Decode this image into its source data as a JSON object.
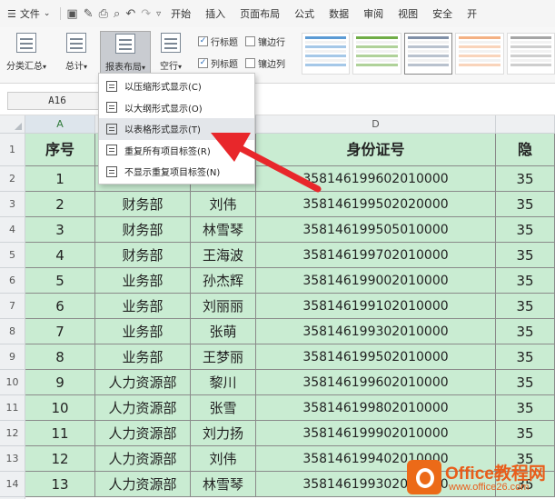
{
  "menubar": {
    "file_label": "文件",
    "tabs": [
      "开始",
      "插入",
      "页面布局",
      "公式",
      "数据",
      "审阅",
      "视图",
      "安全",
      "开"
    ]
  },
  "ribbon": {
    "subtotal_label": "分类汇总",
    "total_label": "总计",
    "report_layout_label": "报表布局",
    "blank_rows_label": "空行",
    "row_headers": {
      "label": "行标题",
      "checked": true
    },
    "banded_rows": {
      "label": "镶边行",
      "checked": false
    },
    "col_headers": {
      "label": "列标题",
      "checked": true
    },
    "banded_cols": {
      "label": "镶边列",
      "checked": false
    },
    "style_colors": [
      "#5b9bd5",
      "#70ad47",
      "#7f8fa6",
      "#f4b183",
      "#a5a5a5"
    ]
  },
  "formula_bar": {
    "name_box": "A16"
  },
  "dropdown": {
    "items": [
      "以压缩形式显示(C)",
      "以大纲形式显示(O)",
      "以表格形式显示(T)",
      "重复所有项目标签(R)",
      "不显示重复项目标签(N)"
    ],
    "highlighted_index": 2
  },
  "sheet": {
    "col_letters": [
      "A",
      "",
      "",
      "D",
      ""
    ],
    "row_numbers": [
      "1",
      "2",
      "3",
      "4",
      "5",
      "6",
      "7",
      "8",
      "9",
      "10",
      "11",
      "12",
      "13",
      "14"
    ],
    "headers": [
      "序号",
      "",
      "",
      "身份证号",
      "隐"
    ],
    "rows": [
      [
        "1",
        "",
        "",
        "358146199602010000",
        "35"
      ],
      [
        "2",
        "财务部",
        "刘伟",
        "358146199502020000",
        "35"
      ],
      [
        "3",
        "财务部",
        "林雪琴",
        "358146199505010000",
        "35"
      ],
      [
        "4",
        "财务部",
        "王海波",
        "358146199702010000",
        "35"
      ],
      [
        "5",
        "业务部",
        "孙杰辉",
        "358146199002010000",
        "35"
      ],
      [
        "6",
        "业务部",
        "刘丽丽",
        "358146199102010000",
        "35"
      ],
      [
        "7",
        "业务部",
        "张萌",
        "358146199302010000",
        "35"
      ],
      [
        "8",
        "业务部",
        "王梦丽",
        "358146199502010000",
        "35"
      ],
      [
        "9",
        "人力资源部",
        "黎川",
        "358146199602010000",
        "35"
      ],
      [
        "10",
        "人力资源部",
        "张雪",
        "358146199802010000",
        "35"
      ],
      [
        "11",
        "人力资源部",
        "刘力扬",
        "358146199902010000",
        "35"
      ],
      [
        "12",
        "人力资源部",
        "刘伟",
        "358146199402010000",
        "35"
      ],
      [
        "13",
        "人力资源部",
        "林雪琴",
        "358146199302010000",
        "35"
      ]
    ],
    "fill_color": "#c9ecd2"
  },
  "watermark": {
    "line1": "Office教程网",
    "line2": "www.office26.com"
  }
}
